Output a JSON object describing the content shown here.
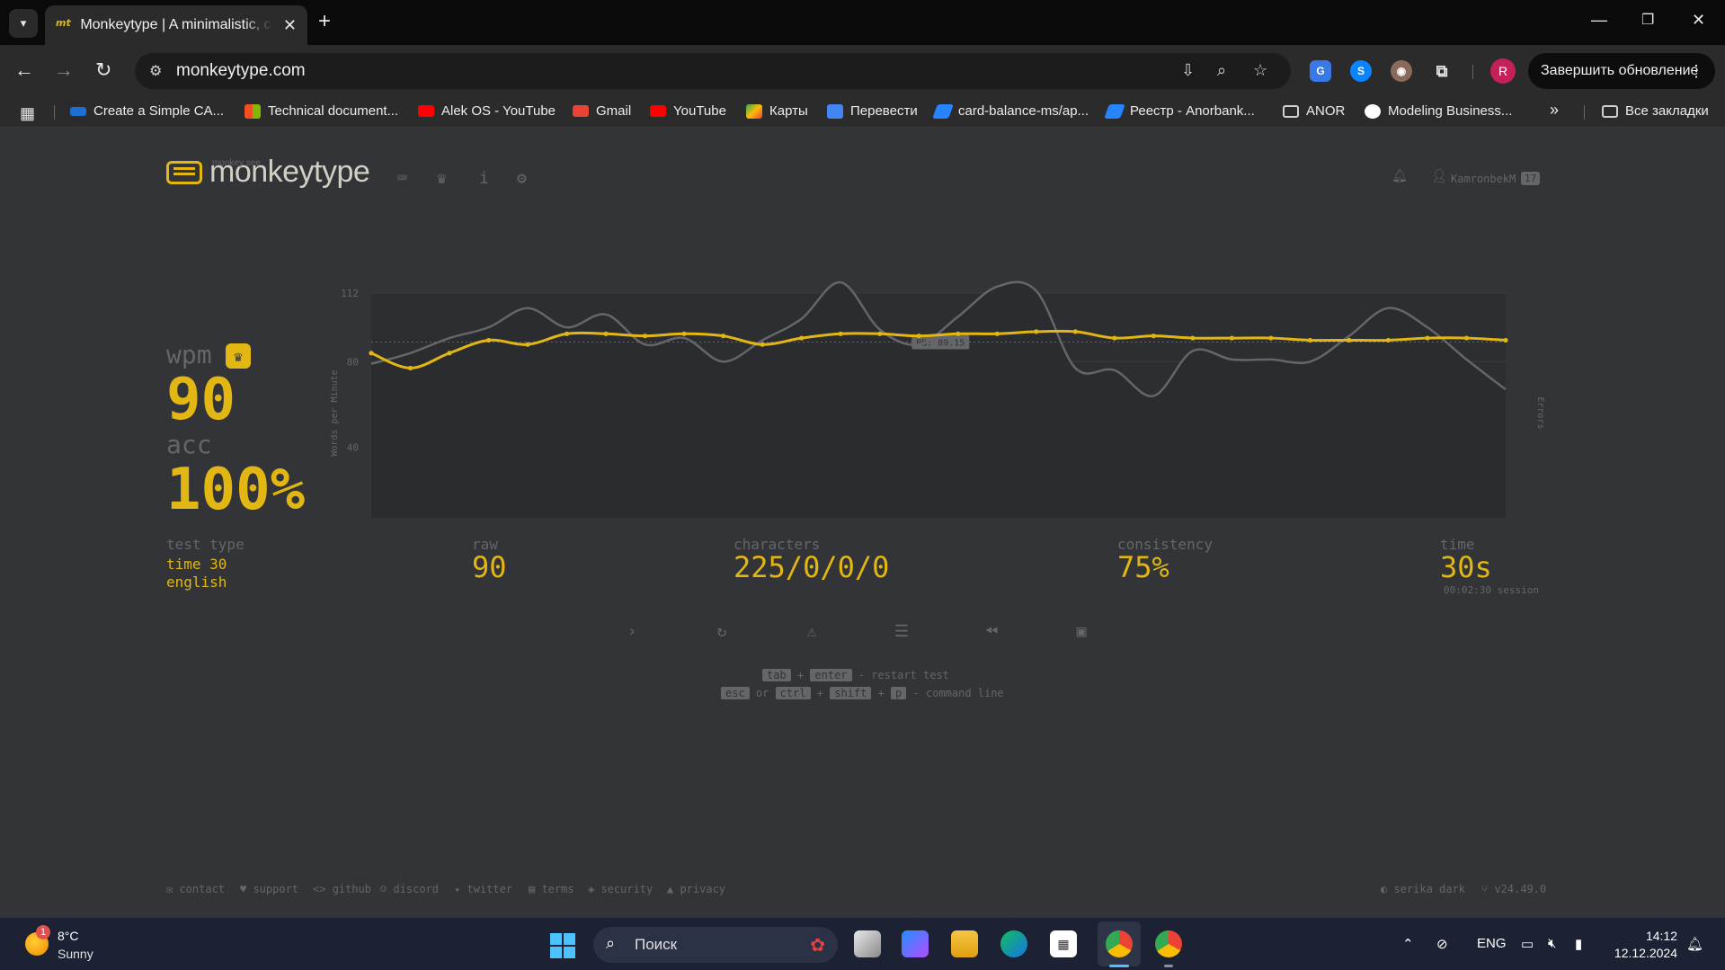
{
  "browser": {
    "tab_title": "Monkeytype | A minimalistic, customizable typing test",
    "tab_favicon": "mt",
    "url": "monkeytype.com",
    "update_button": "Завершить обновление",
    "profile_initial": "R"
  },
  "bookmarks": [
    {
      "label": "Create a Simple CA...",
      "color": "#1d6fd6"
    },
    {
      "label": "Technical document...",
      "color": "#f25022"
    },
    {
      "label": "Alek OS - YouTube",
      "color": "#ff0000"
    },
    {
      "label": "Gmail",
      "color": "#ea4335"
    },
    {
      "label": "YouTube",
      "color": "#ff0000"
    },
    {
      "label": "Карты",
      "color": "#34a853"
    },
    {
      "label": "Перевести",
      "color": "#4285f4"
    },
    {
      "label": "card-balance-ms/ap...",
      "color": "#2684ff"
    },
    {
      "label": "Реестр - Anorbank...",
      "color": "#2684ff"
    },
    {
      "label": "ANOR",
      "color": "folder"
    },
    {
      "label": "Modeling Business...",
      "color": "#ffffff"
    }
  ],
  "bookmarks_all": "Все закладки",
  "monkeytype": {
    "logo_sup": "monkey see",
    "logo": "monkeytype",
    "username": "KamronbekM",
    "level": "17",
    "wpm_label": "wpm",
    "wpm_value": "90",
    "acc_label": "acc",
    "acc_value": "100%",
    "test_type_label": "test type",
    "test_type_line1": "time 30",
    "test_type_line2": "english",
    "raw_label": "raw",
    "raw_value": "90",
    "characters_label": "characters",
    "characters_value": "225/0/0/0",
    "consistency_label": "consistency",
    "consistency_value": "75%",
    "time_label": "time",
    "time_value": "30s",
    "session": "00:02:30 session",
    "hints": {
      "tab": "tab",
      "plus": "+",
      "enter": "enter",
      "restart": "- restart test",
      "esc": "esc",
      "or": "or",
      "ctrl": "ctrl",
      "shift": "shift",
      "p": "p",
      "command_line": "- command line"
    },
    "footer": [
      "contact",
      "support",
      "github",
      "discord",
      "twitter",
      "terms",
      "security",
      "privacy"
    ],
    "theme": "serika dark",
    "version": "v24.49.0",
    "accent_color": "#e2b714",
    "sub_color": "#646669",
    "bg_color": "#323437"
  },
  "chart_data": {
    "type": "line",
    "x": [
      1,
      2,
      3,
      4,
      5,
      6,
      7,
      8,
      9,
      10,
      11,
      12,
      13,
      14,
      15,
      16,
      17,
      18,
      19,
      20,
      21,
      22,
      23,
      24,
      25,
      26,
      27,
      28,
      29,
      30
    ],
    "series": [
      {
        "name": "wpm",
        "color": "#e2b714",
        "values": [
          84,
          77,
          84,
          90,
          88,
          93,
          93,
          92,
          93,
          92,
          88,
          91,
          93,
          93,
          92,
          93,
          93,
          94,
          94,
          91,
          92,
          91,
          91,
          91,
          90,
          90,
          90,
          91,
          91,
          90
        ]
      },
      {
        "name": "raw",
        "color": "#646669",
        "values": [
          79,
          84,
          91,
          96,
          105,
          96,
          102,
          88,
          91,
          80,
          90,
          100,
          117,
          95,
          88,
          101,
          115,
          113,
          77,
          76,
          64,
          85,
          81,
          81,
          80,
          92,
          105,
          96,
          81,
          67
        ]
      }
    ],
    "ylabel": "Words per Minute",
    "y2label": "Errors",
    "ylim": [
      0,
      112
    ],
    "yticks": [
      0,
      40,
      80,
      112
    ],
    "pb_label": "PB: 89.15",
    "pb_value": 89.15
  },
  "taskbar": {
    "weather_badge": "1",
    "weather_temp": "8°C",
    "weather_desc": "Sunny",
    "search_placeholder": "Поиск",
    "lang": "ENG",
    "time": "14:12",
    "date": "12.12.2024"
  }
}
